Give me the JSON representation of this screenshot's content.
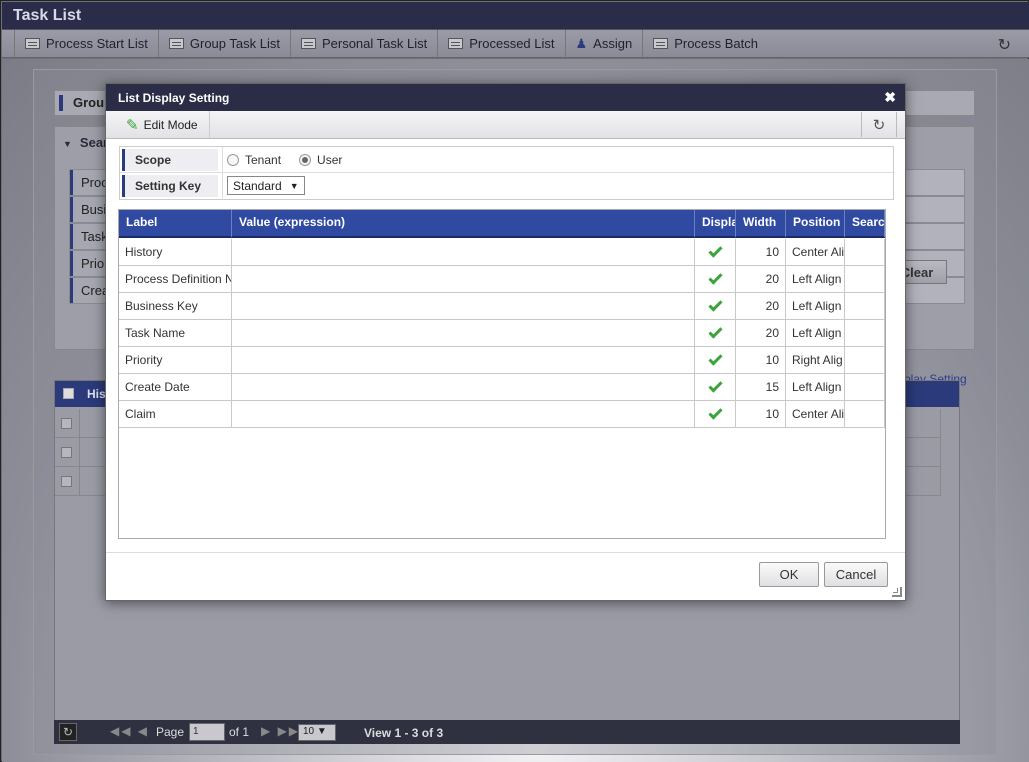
{
  "window": {
    "title": "Task List"
  },
  "toolbar": {
    "items": [
      {
        "label": "Process Start List",
        "icon": "list-icon"
      },
      {
        "label": "Group Task List",
        "icon": "list-icon"
      },
      {
        "label": "Personal Task List",
        "icon": "list-icon"
      },
      {
        "label": "Processed List",
        "icon": "list-icon"
      },
      {
        "label": "Assign",
        "icon": "user-icon"
      },
      {
        "label": "Process Batch",
        "icon": "batch-icon"
      }
    ],
    "refresh_icon": "refresh-icon"
  },
  "background": {
    "group_title": "Grou",
    "search_title": "Sear",
    "search_rows": [
      "Proc",
      "Busi",
      "Task",
      "Prior",
      "Crea"
    ],
    "clear_label": "Clear",
    "display_setting_link": "play Setting",
    "grid_header": "His",
    "pager": {
      "page_label": "Page",
      "page_value": "1",
      "of_label": "of 1",
      "rows_value": "10",
      "view_info": "View 1 - 3 of 3"
    }
  },
  "dialog": {
    "title": "List Display Setting",
    "edit_mode_label": "Edit Mode",
    "scope": {
      "label": "Scope",
      "options": [
        {
          "label": "Tenant",
          "checked": false
        },
        {
          "label": "User",
          "checked": true
        }
      ]
    },
    "setting_key": {
      "label": "Setting Key",
      "value": "Standard"
    },
    "grid": {
      "headers": [
        "Label",
        "Value (expression)",
        "Displa",
        "Width",
        "Position",
        "Searc"
      ],
      "rows": [
        {
          "label": "History",
          "value": "",
          "display": true,
          "width": "10",
          "position": "Center Ali"
        },
        {
          "label": "Process Definition N",
          "value": "",
          "display": true,
          "width": "20",
          "position": "Left Align"
        },
        {
          "label": "Business Key",
          "value": "",
          "display": true,
          "width": "20",
          "position": "Left Align"
        },
        {
          "label": "Task Name",
          "value": "",
          "display": true,
          "width": "20",
          "position": "Left Align"
        },
        {
          "label": "Priority",
          "value": "",
          "display": true,
          "width": "10",
          "position": "Right Alig"
        },
        {
          "label": "Create Date",
          "value": "",
          "display": true,
          "width": "15",
          "position": "Left Align"
        },
        {
          "label": "Claim",
          "value": "",
          "display": true,
          "width": "10",
          "position": "Center Ali"
        }
      ]
    },
    "ok_label": "OK",
    "cancel_label": "Cancel"
  },
  "colors": {
    "title_bar": "#2a2c4a",
    "grid_header": "#2f4aa0",
    "check_green": "#3aa53a"
  }
}
